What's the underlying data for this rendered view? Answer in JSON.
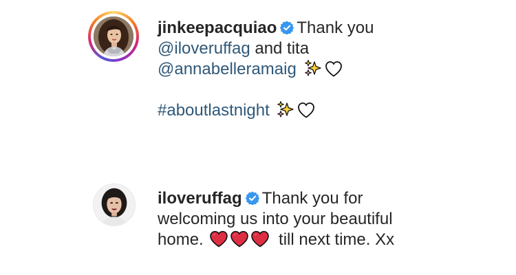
{
  "comments": [
    {
      "username": "jinkeepacquiao",
      "verified": true,
      "has_story_ring": true,
      "lines": {
        "line1": "Thank you",
        "mention1": "@iloveruffag",
        "line2_rest": "and tita",
        "mention2": "@annabelleramaig",
        "hashtag": "#aboutlastnight"
      },
      "emojis": [
        "sparkles-icon",
        "white-heart-icon"
      ]
    },
    {
      "username": "iloveruffag",
      "verified": true,
      "has_story_ring": false,
      "lines": {
        "line1": "Thank you for",
        "line2": "welcoming us into your beautiful",
        "line3_start": "home.",
        "line3_end": "till next time. Xx"
      },
      "emojis": [
        "red-heart-icon",
        "red-heart-icon",
        "red-heart-icon"
      ]
    }
  ],
  "colors": {
    "link": "#2f5878",
    "text": "#262626",
    "verified_badge": "#3897f0",
    "heart_red": "#dd2e44"
  }
}
